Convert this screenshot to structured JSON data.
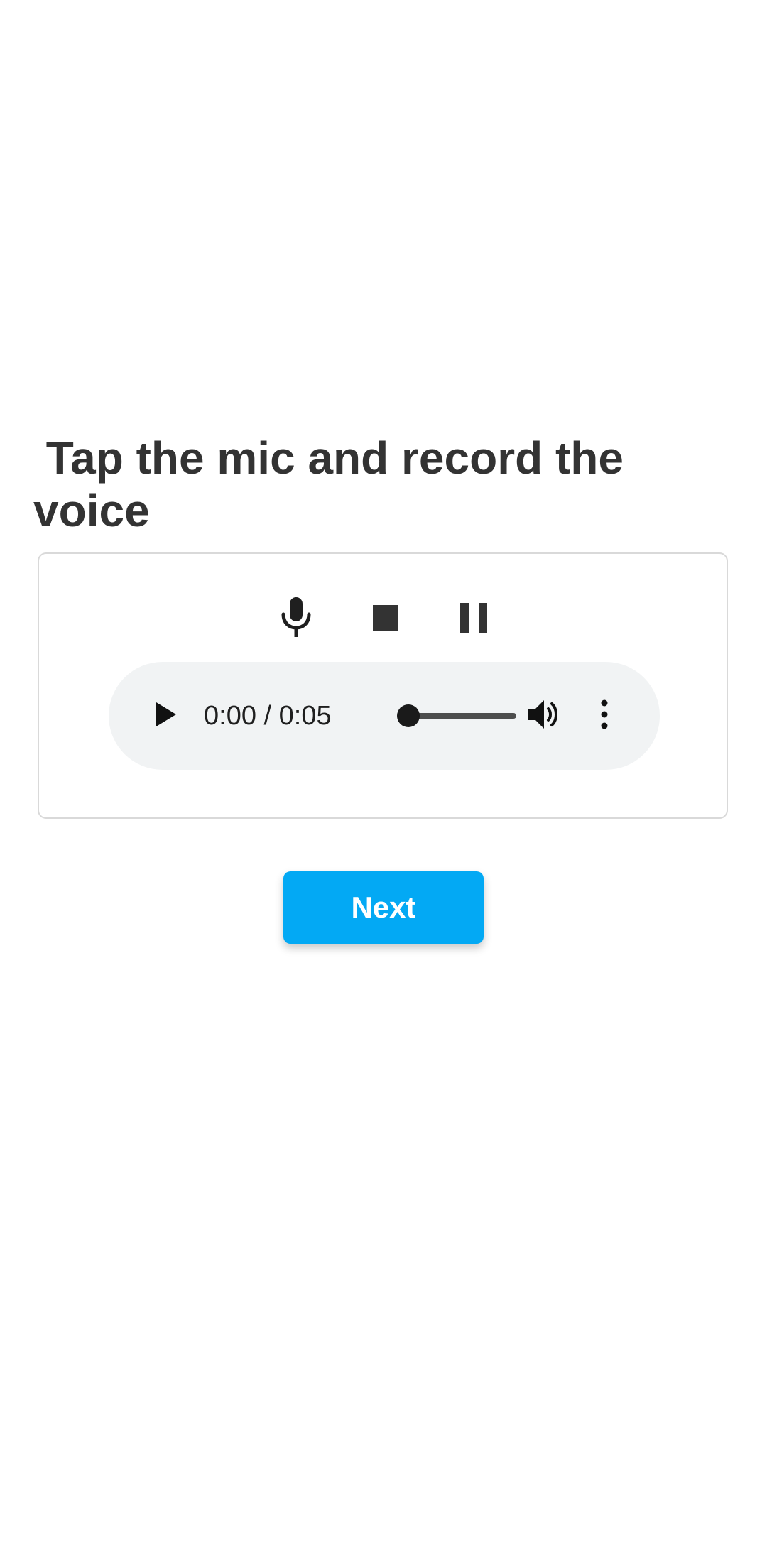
{
  "prompt": {
    "title": " Tap the mic and record the voice"
  },
  "recorder": {
    "controls": [
      {
        "name": "mic-icon",
        "icon": "microphone"
      },
      {
        "name": "stop-icon",
        "icon": "stop-square"
      },
      {
        "name": "pause-icon",
        "icon": "pause-bars"
      }
    ]
  },
  "audio_player": {
    "time_display": "0:00 / 0:05",
    "progress_fraction": 0,
    "icons": {
      "play": "play-triangle",
      "volume": "speaker-volume",
      "more": "vertical-ellipsis"
    }
  },
  "actions": {
    "next_label": "Next"
  },
  "colors": {
    "accent": "#03a9f4",
    "text": "#333333",
    "player_bg": "#f1f3f4",
    "card_border": "#d9d9d9"
  }
}
